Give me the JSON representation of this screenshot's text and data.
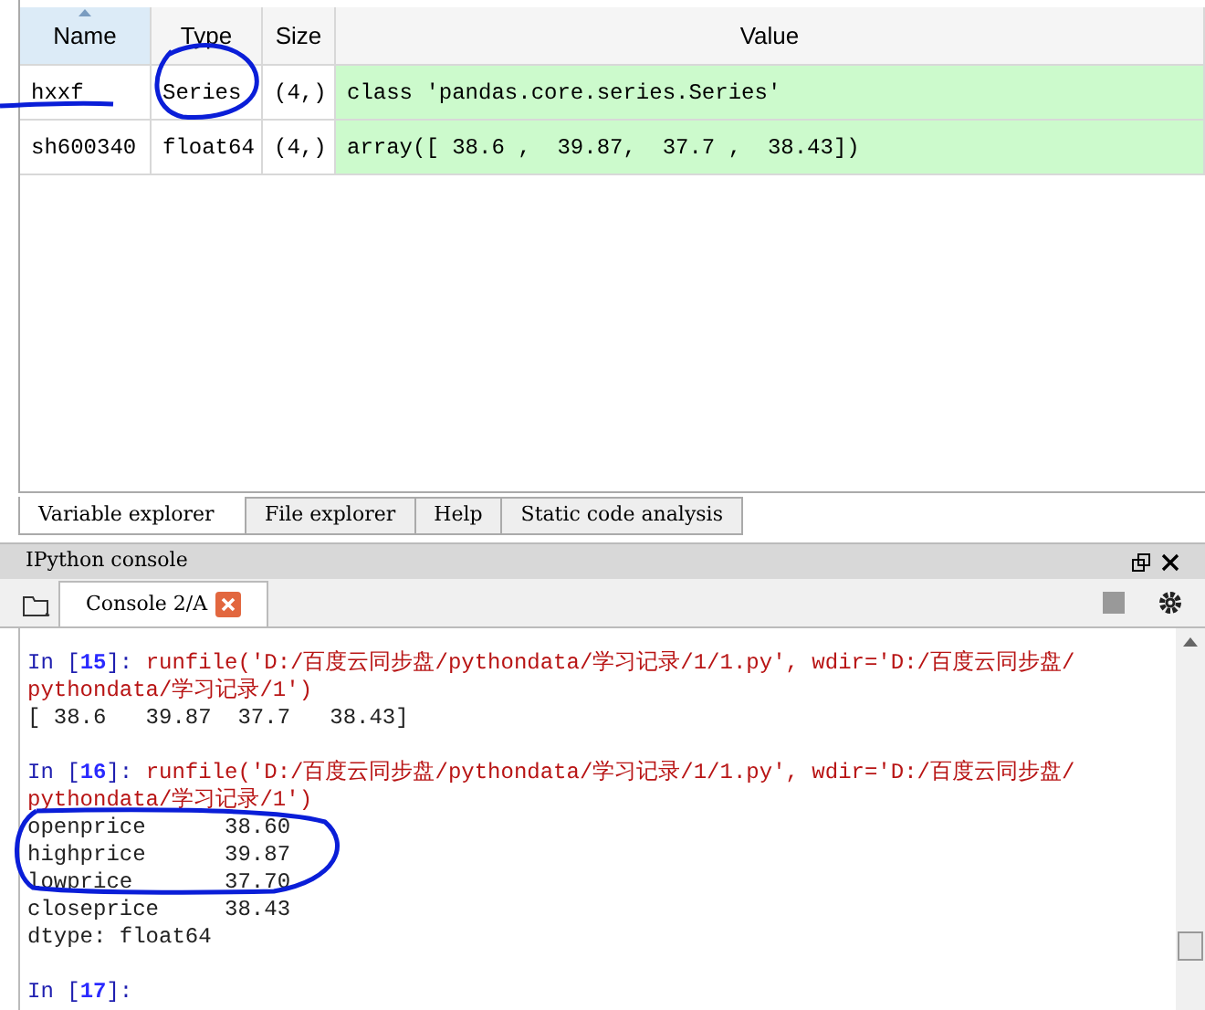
{
  "variable_table": {
    "columns": [
      {
        "label": "Name",
        "sorted": true
      },
      {
        "label": "Type",
        "sorted": false
      },
      {
        "label": "Size",
        "sorted": false
      },
      {
        "label": "Value",
        "sorted": false
      }
    ],
    "rows": [
      {
        "name": "hxxf",
        "type": "Series",
        "size": "(4,)",
        "value": "class 'pandas.core.series.Series'"
      },
      {
        "name": "sh600340",
        "type": "float64",
        "size": "(4,)",
        "value": "array([ 38.6 ,  39.87,  37.7 ,  38.43])"
      }
    ]
  },
  "pane_tabs": [
    {
      "label": "Variable explorer",
      "selected": true
    },
    {
      "label": "File explorer",
      "selected": false
    },
    {
      "label": "Help",
      "selected": false
    },
    {
      "label": "Static code analysis",
      "selected": false
    }
  ],
  "console_pane": {
    "title": "IPython console",
    "tab": {
      "label": "Console 2/A",
      "selected": true
    },
    "entries": [
      {
        "prompt_before": "In [",
        "number": "15",
        "prompt_after": "]: ",
        "code_lines": [
          "runfile('D:/百度云同步盘/pythondata/学习记录/1/1.py', wdir='D:/百度云同步盘/",
          "pythondata/学习记录/1')"
        ],
        "output": [
          "[ 38.6   39.87  37.7   38.43]"
        ]
      },
      {
        "prompt_before": "In [",
        "number": "16",
        "prompt_after": "]: ",
        "code_lines": [
          "runfile('D:/百度云同步盘/pythondata/学习记录/1/1.py', wdir='D:/百度云同步盘/",
          "pythondata/学习记录/1')"
        ],
        "output": [
          "openprice      38.60",
          "highprice      39.87",
          "lowprice       37.70",
          "closeprice     38.43",
          "dtype: float64"
        ]
      },
      {
        "prompt_before": "In [",
        "number": "17",
        "prompt_after": "]:"
      }
    ]
  }
}
